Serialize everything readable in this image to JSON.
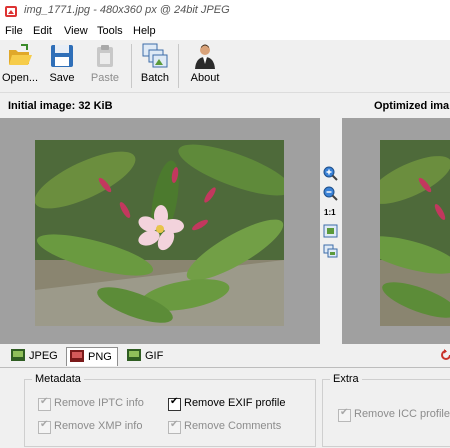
{
  "window": {
    "title": "img_1771.jpg - 480x360 px @ 24bit JPEG"
  },
  "menu": {
    "items": [
      "File",
      "Edit",
      "View",
      "Tools",
      "Help"
    ]
  },
  "toolbar": {
    "open_label": "Open...",
    "save_label": "Save",
    "paste_label": "Paste",
    "batch_label": "Batch",
    "about_label": "About"
  },
  "sizes": {
    "initial_label": "Initial image:",
    "initial_value": "32 KiB",
    "optimized_label": "Optimized ima"
  },
  "zoom": {
    "ratio_label": "1:1"
  },
  "format_tabs": [
    {
      "label": "JPEG",
      "active": false
    },
    {
      "label": "PNG",
      "active": true
    },
    {
      "label": "GIF",
      "active": false
    }
  ],
  "metadata": {
    "legend": "Metadata",
    "options": [
      {
        "label": "Remove IPTC info",
        "checked": true,
        "enabled": false
      },
      {
        "label": "Remove EXIF profile",
        "checked": true,
        "enabled": true
      },
      {
        "label": "Remove XMP info",
        "checked": true,
        "enabled": false
      },
      {
        "label": "Remove Comments",
        "checked": true,
        "enabled": false
      }
    ]
  },
  "extra": {
    "legend": "Extra",
    "options": [
      {
        "label": "Remove ICC profile",
        "checked": true,
        "enabled": false
      }
    ]
  }
}
